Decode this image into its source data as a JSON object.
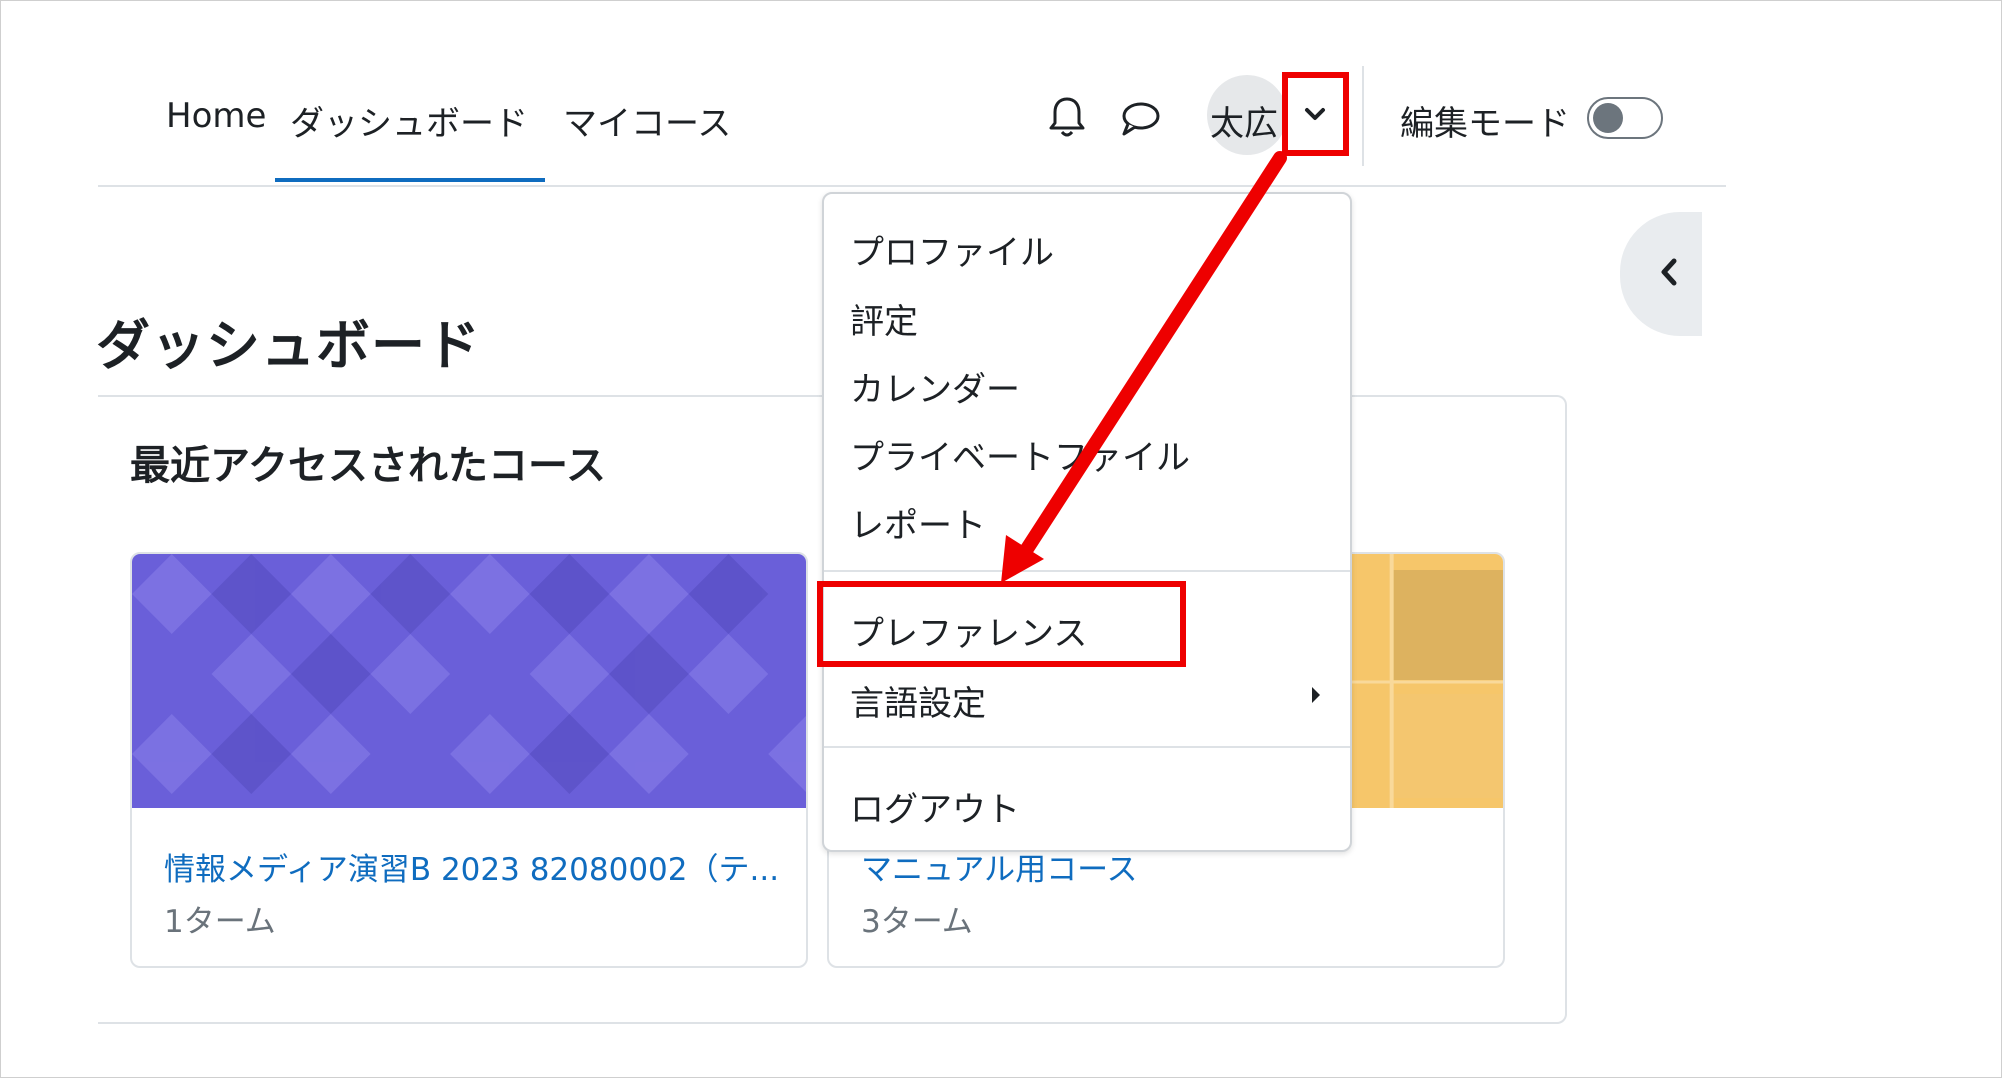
{
  "nav": {
    "home": "Home",
    "dashboard": "ダッシュボード",
    "my_courses": "マイコース"
  },
  "header": {
    "user_name": "太広",
    "edit_mode_label": "編集モード"
  },
  "page": {
    "title": "ダッシュボード"
  },
  "recent_courses": {
    "title": "最近アクセスされたコース",
    "courses": [
      {
        "name": "情報メディア演習B 2023 82080002（テ...",
        "term": "1ターム"
      },
      {
        "name": "マニュアル用コース",
        "term": "3ターム"
      }
    ]
  },
  "user_menu": {
    "items": [
      {
        "label": "プロファイル"
      },
      {
        "label": "評定"
      },
      {
        "label": "カレンダー"
      },
      {
        "label": "プライベートファイル"
      },
      {
        "label": "レポート"
      },
      {
        "label": "プレファレンス"
      },
      {
        "label": "言語設定"
      },
      {
        "label": "ログアウト"
      }
    ]
  },
  "colors": {
    "accent": "#0f6cbf",
    "highlight": "#ee0000",
    "course1_image": "#6a5fd9",
    "course2_image": "#f6c66a"
  }
}
